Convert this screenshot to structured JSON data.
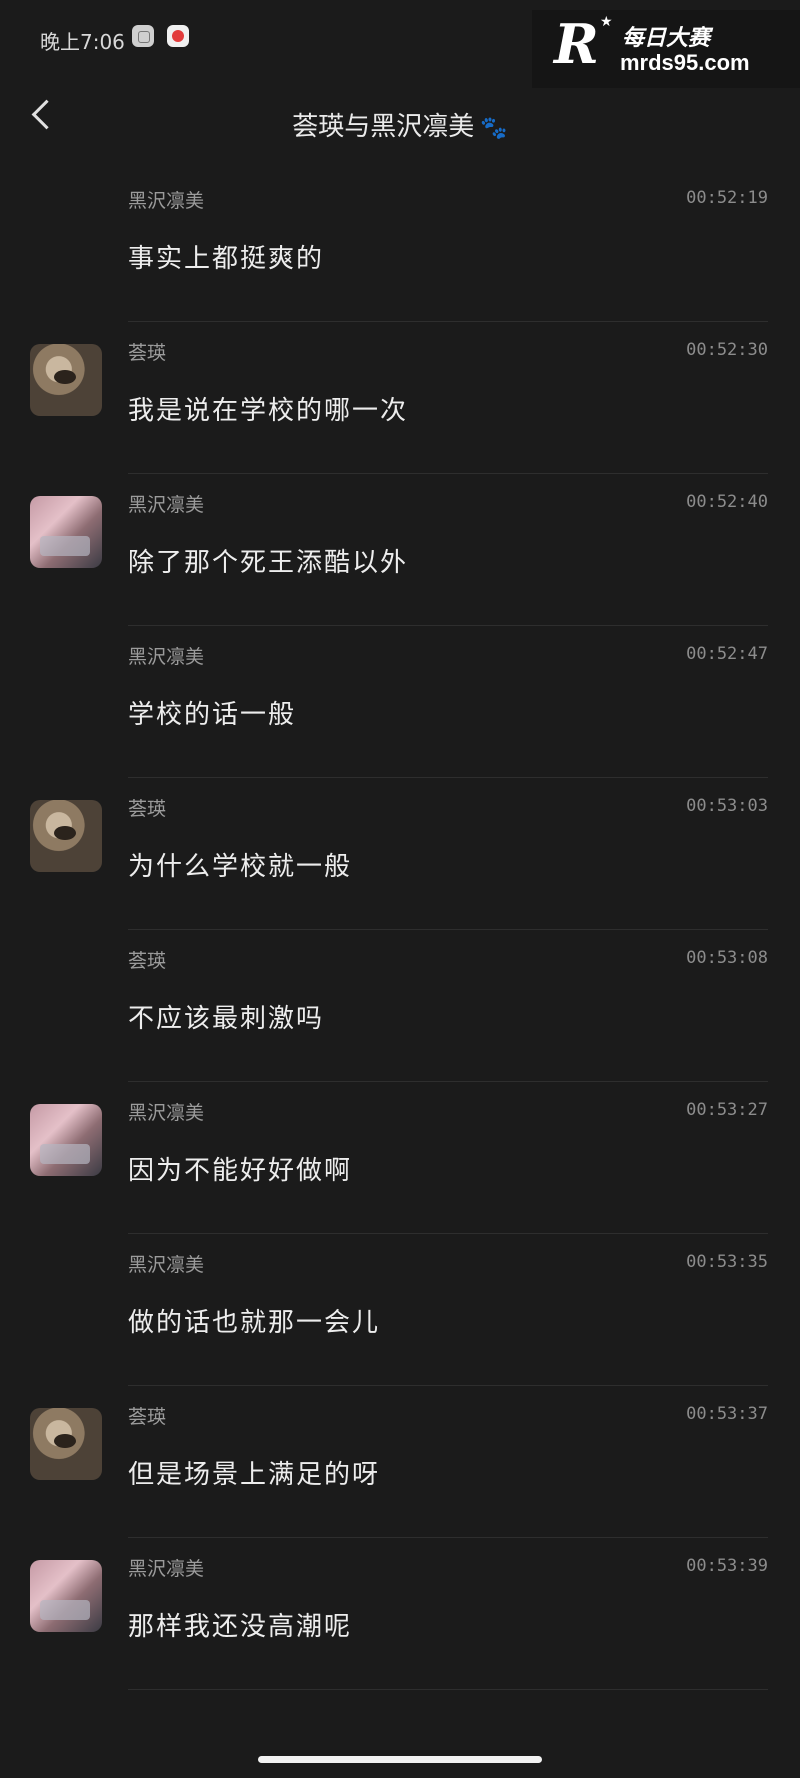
{
  "status": {
    "time": "晚上7:06",
    "icons": [
      "app-icon",
      "record-icon"
    ]
  },
  "watermark": {
    "brand": "每日大赛",
    "url": "mrds95.com"
  },
  "header": {
    "title": "荟瑛与黑沢凛美",
    "title_icon": "paw-icon"
  },
  "messages": [
    {
      "name": "黑沢凛美",
      "time": "00:52:19",
      "text": "事实上都挺爽的",
      "avatar": "none"
    },
    {
      "name": "荟瑛",
      "time": "00:52:30",
      "text": "我是说在学校的哪一次",
      "avatar": "cat"
    },
    {
      "name": "黑沢凛美",
      "time": "00:52:40",
      "text": "除了那个死王添酷以外",
      "avatar": "pink"
    },
    {
      "name": "黑沢凛美",
      "time": "00:52:47",
      "text": "学校的话一般",
      "avatar": "none"
    },
    {
      "name": "荟瑛",
      "time": "00:53:03",
      "text": "为什么学校就一般",
      "avatar": "cat"
    },
    {
      "name": "荟瑛",
      "time": "00:53:08",
      "text": "不应该最刺激吗",
      "avatar": "none"
    },
    {
      "name": "黑沢凛美",
      "time": "00:53:27",
      "text": "因为不能好好做啊",
      "avatar": "pink"
    },
    {
      "name": "黑沢凛美",
      "time": "00:53:35",
      "text": "做的话也就那一会儿",
      "avatar": "none"
    },
    {
      "name": "荟瑛",
      "time": "00:53:37",
      "text": "但是场景上满足的呀",
      "avatar": "cat"
    },
    {
      "name": "黑沢凛美",
      "time": "00:53:39",
      "text": "那样我还没高潮呢",
      "avatar": "pink"
    }
  ]
}
